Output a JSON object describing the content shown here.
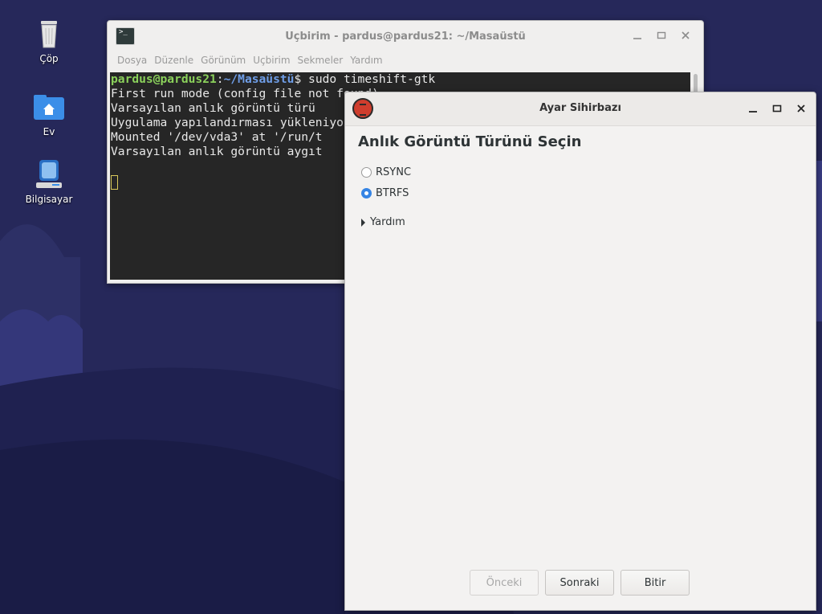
{
  "desktop": {
    "icons": [
      {
        "label": "Çöp",
        "icon": "trash-icon"
      },
      {
        "label": "Ev",
        "icon": "home-folder-icon"
      },
      {
        "label": "Bilgisayar",
        "icon": "computer-icon"
      }
    ]
  },
  "terminal": {
    "title": "Uçbirim - pardus@pardus21: ~/Masaüstü",
    "menu": [
      "Dosya",
      "Düzenle",
      "Görünüm",
      "Uçbirim",
      "Sekmeler",
      "Yardım"
    ],
    "prompt_user": "pardus@pardus21",
    "prompt_sep": ":",
    "prompt_path": "~/Masaüstü",
    "prompt_end": "$",
    "command": " sudo timeshift-gtk",
    "output": [
      "First run mode (config file not found)",
      "Varsayılan anlık görüntü türü",
      "Uygulama yapılandırması yükleniyor",
      "Mounted '/dev/vda3' at '/run/t",
      "Varsayılan anlık görüntü aygıt"
    ]
  },
  "wizard": {
    "title": "Ayar Sihirbazı",
    "heading": "Anlık Görüntü Türünü Seçin",
    "options": [
      {
        "label": "RSYNC",
        "checked": false
      },
      {
        "label": "BTRFS",
        "checked": true
      }
    ],
    "expander_label": "Yardım",
    "buttons": {
      "previous": "Önceki",
      "next": "Sonraki",
      "finish": "Bitir"
    }
  },
  "colors": {
    "wallpaper": "#26285a",
    "accent": "#3584e4",
    "prompt_user": "#8bd15b",
    "prompt_path": "#6f9ee8"
  }
}
